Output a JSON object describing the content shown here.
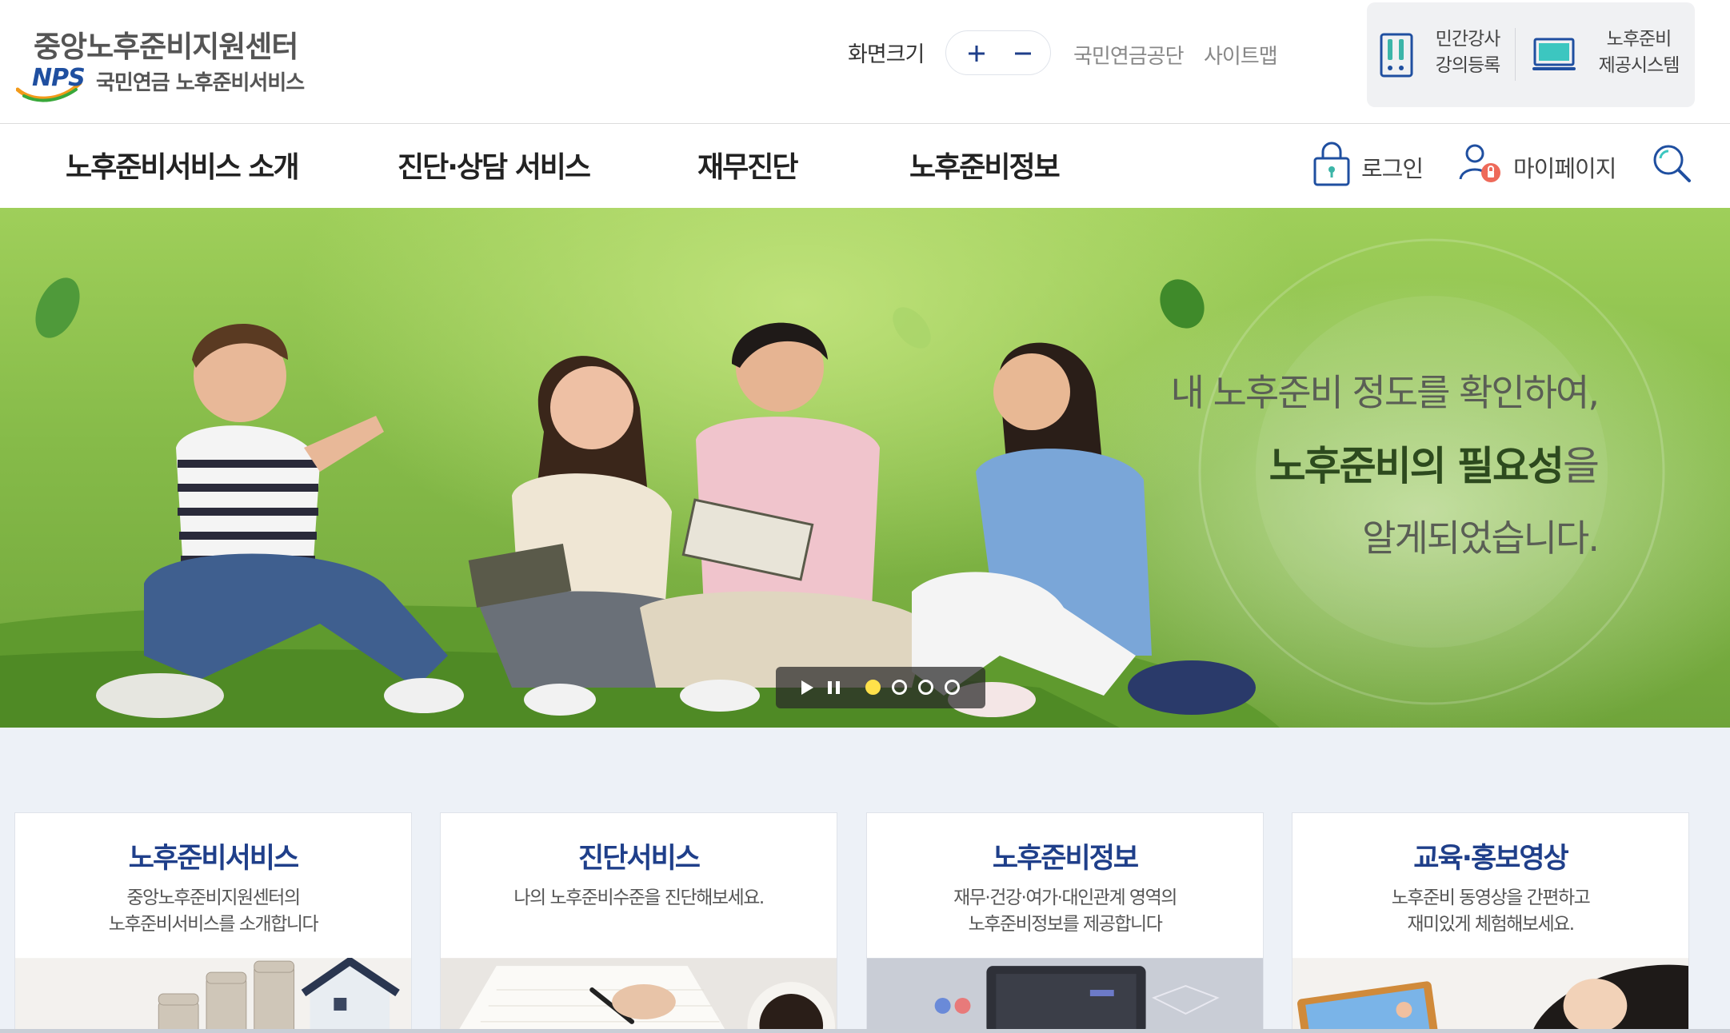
{
  "header": {
    "logo_title": "중앙노후준비지원센터",
    "logo_nps": "NPS",
    "logo_subtext": "국민연금 노후준비서비스",
    "font_size_label": "화면크기",
    "links": {
      "nps": "국민연금공단",
      "sitemap": "사이트맵"
    },
    "quick": [
      {
        "line1": "민간강사",
        "line2": "강의등록",
        "icon": "book-icon"
      },
      {
        "line1": "노후준비",
        "line2": "제공시스템",
        "icon": "monitor-icon"
      }
    ]
  },
  "nav": {
    "items": [
      "노후준비서비스 소개",
      "진단·상담 서비스",
      "재무진단",
      "노후준비정보"
    ],
    "login": "로그인",
    "mypage": "마이페이지"
  },
  "hero": {
    "line1": "내 노후준비 정도를 확인하여,",
    "line2_strong": "노후준비의 필요성",
    "line2_rest": "을",
    "line3": "알게되었습니다.",
    "active_slide": 1,
    "slide_count": 4
  },
  "cards": [
    {
      "title": "노후준비서비스",
      "desc": [
        "중앙노후준비지원센터의",
        "노후준비서비스를 소개합니다"
      ]
    },
    {
      "title": "진단서비스",
      "desc": [
        "나의 노후준비수준을 진단해보세요."
      ]
    },
    {
      "title": "노후준비정보",
      "desc": [
        "재무·건강·여가·대인관계 영역의",
        "노후준비정보를 제공합니다"
      ]
    },
    {
      "title": "교육·홍보영상",
      "desc": [
        "노후준비 동영상을 간편하고",
        "재미있게 체험해보세요."
      ]
    }
  ],
  "colors": {
    "brand_blue": "#1f3f8a",
    "nps_blue": "#1f4fa0",
    "hero_green": "#86bb49",
    "card_bg": "#edf1f7",
    "active_dot": "#ffe14a"
  }
}
